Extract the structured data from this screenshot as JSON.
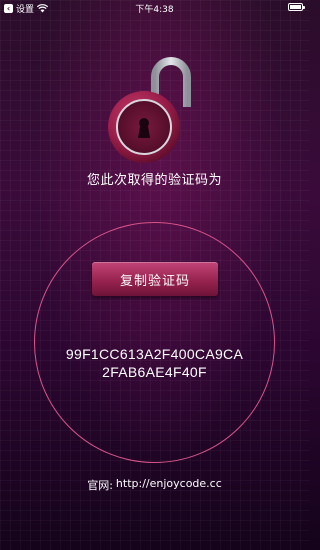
{
  "status_bar": {
    "back_label": "设置",
    "time": "下午4:38",
    "icons": [
      "back-arrow-icon",
      "wifi-icon",
      "battery-icon"
    ]
  },
  "lock": {
    "icon": "padlock-open-icon",
    "colors": {
      "body": "#a3234f",
      "shackle": "#b9bcc4"
    }
  },
  "prompt": "您此次取得的验证码为",
  "copy_button": "复制验证码",
  "code": {
    "line1": "99F1CC613A2F400CA9CA",
    "line2": "2FAB6AE4F40F"
  },
  "footer": {
    "label": "官网:",
    "url": "http://enjoycode.cc"
  },
  "colors": {
    "accent": "#d9548a",
    "button": "#98234f",
    "background": "#2a0d2a"
  }
}
